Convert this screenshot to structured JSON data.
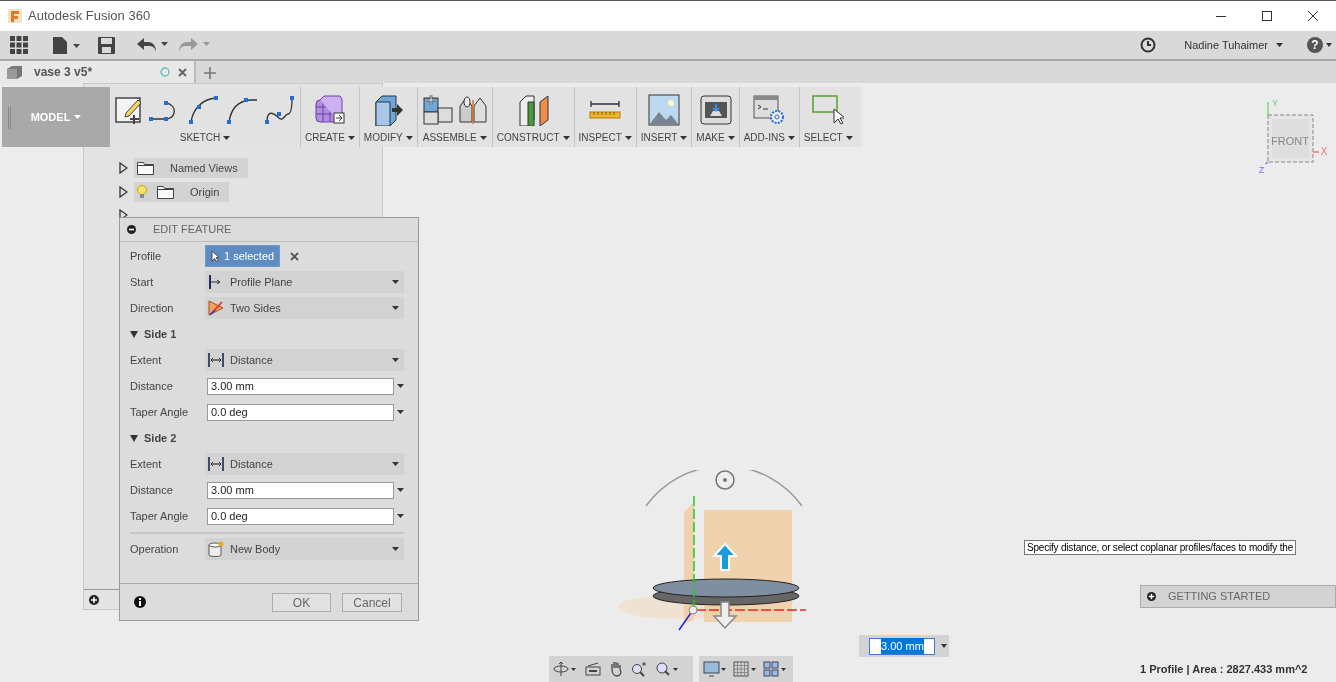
{
  "window": {
    "title": "Autodesk Fusion 360"
  },
  "quick_access": {
    "user": "Nadine Tuhaimer",
    "help": "?"
  },
  "document_tab": {
    "title": "vase 3 v5*"
  },
  "workspace": {
    "label": "MODEL"
  },
  "toolbar_groups": [
    {
      "label": "SKETCH",
      "kind": "sketch"
    },
    {
      "label": "CREATE",
      "kind": "create"
    },
    {
      "label": "MODIFY",
      "kind": "modify"
    },
    {
      "label": "ASSEMBLE",
      "kind": "assemble"
    },
    {
      "label": "CONSTRUCT",
      "kind": "construct"
    },
    {
      "label": "INSPECT",
      "kind": "inspect"
    },
    {
      "label": "INSERT",
      "kind": "insert"
    },
    {
      "label": "MAKE",
      "kind": "make"
    },
    {
      "label": "ADD-INS",
      "kind": "addins"
    },
    {
      "label": "SELECT",
      "kind": "select"
    }
  ],
  "browser": {
    "items": [
      {
        "label": "Named Views",
        "kind": "folder"
      },
      {
        "label": "Origin",
        "kind": "bulb-folder"
      }
    ]
  },
  "dialog": {
    "title": "EDIT FEATURE",
    "rows": [
      {
        "kind": "selection",
        "label": "Profile",
        "value": "1 selected"
      },
      {
        "kind": "dropdown",
        "label": "Start",
        "value": "Profile Plane"
      },
      {
        "kind": "dropdown",
        "label": "Direction",
        "value": "Two Sides"
      },
      {
        "kind": "section",
        "label": "Side 1",
        "expanded": true
      },
      {
        "kind": "dropdown",
        "label": "Extent",
        "value": "Distance"
      },
      {
        "kind": "input",
        "label": "Distance",
        "value": "3.00 mm"
      },
      {
        "kind": "input",
        "label": "Taper Angle",
        "value": "0.0 deg"
      },
      {
        "kind": "section",
        "label": "Side 2",
        "expanded": true
      },
      {
        "kind": "dropdown",
        "label": "Extent",
        "value": "Distance"
      },
      {
        "kind": "input",
        "label": "Distance",
        "value": "3.00 mm"
      },
      {
        "kind": "input",
        "label": "Taper Angle",
        "value": "0.0 deg"
      },
      {
        "kind": "separator"
      },
      {
        "kind": "dropdown",
        "label": "Operation",
        "value": "New Body"
      }
    ],
    "buttons": [
      "OK",
      "Cancel"
    ]
  },
  "viewcube": {
    "face": "FRONT",
    "axes": {
      "y": "Y",
      "x": "X",
      "z": "Z"
    }
  },
  "value_input": {
    "value": "3.00 mm"
  },
  "tooltip": {
    "text": "Specify distance, or select coplanar profiles/faces to modify the"
  },
  "getting_started": {
    "label": "GETTING STARTED"
  },
  "status": {
    "text": "1 Profile | Area : 2827.433 mm^2"
  }
}
